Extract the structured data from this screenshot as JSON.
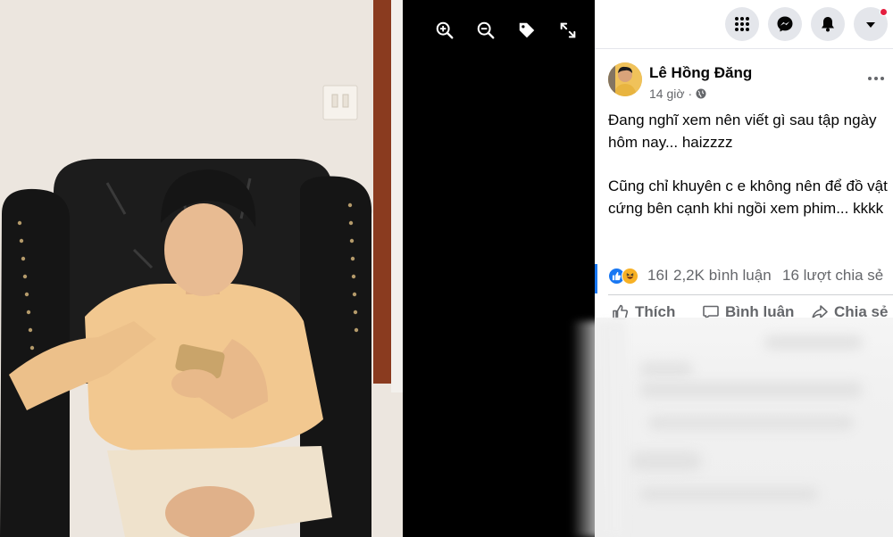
{
  "viewer": {
    "tools": [
      {
        "name": "zoom-in-icon"
      },
      {
        "name": "zoom-out-icon"
      },
      {
        "name": "tag-icon"
      },
      {
        "name": "fullscreen-icon"
      }
    ]
  },
  "topbar": {
    "buttons": [
      "menu-grid-icon",
      "messenger-icon",
      "notifications-bell-icon",
      "account-caret-icon"
    ],
    "has_notification": true
  },
  "post": {
    "author": "Lê Hồng Đăng",
    "time": "14 giờ",
    "privacy_icon": "globe-icon",
    "paragraph1": "Đang nghĩ xem nên viết gì sau tập ngày hôm nay... haizzzz",
    "paragraph2": "Cũng chỉ khuyên c e không nên để đồ vật cứng bên cạnh khi ngồi xem phim... kkkk",
    "reaction_count": "16I",
    "comments": "2,2K bình luận",
    "shares": "16 lượt chia sẻ",
    "actions": {
      "like": "Thích",
      "comment": "Bình luận",
      "share": "Chia sẻ"
    }
  },
  "colors": {
    "accent": "#1877f2",
    "text": "#050505",
    "muted": "#65676b",
    "notif": "#e41e3f"
  }
}
